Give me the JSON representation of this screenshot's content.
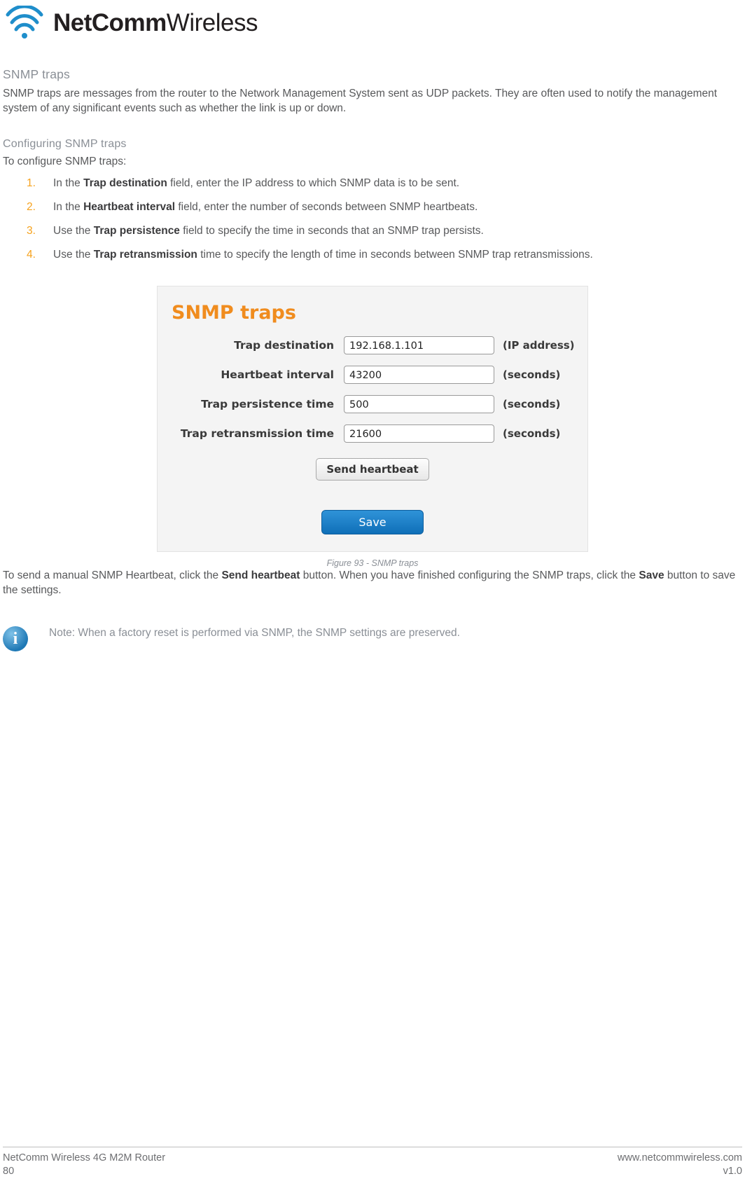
{
  "header": {
    "logo_bold": "NetComm",
    "logo_light": "Wireless",
    "logo_icon": "wifi-arc-icon"
  },
  "content": {
    "section_title": "SNMP traps",
    "intro_paragraph": "SNMP traps are messages from the router to the Network Management System sent as UDP packets. They are often used to notify the management system of any significant events such as whether the link is up or down.",
    "sub_title": "Configuring SNMP traps",
    "lead_in": "To configure SNMP traps:",
    "steps": [
      {
        "pre": "In the ",
        "bold": "Trap destination",
        "post": " field, enter the IP address to which SNMP data is to be sent."
      },
      {
        "pre": "In the ",
        "bold": "Heartbeat interval",
        "post": " field, enter the number of seconds between SNMP heartbeats."
      },
      {
        "pre": "Use the ",
        "bold": "Trap persistence",
        "post": " field to specify the time in seconds that an SNMP trap persists."
      },
      {
        "pre": "Use the ",
        "bold": "Trap retransmission",
        "post": " time to specify the length of time in seconds between SNMP trap retransmissions."
      }
    ],
    "closing": {
      "p1": "To send a manual SNMP Heartbeat, click the ",
      "b1": "Send heartbeat",
      "p2": " button. When you have finished configuring the SNMP traps, click the ",
      "b2": "Save",
      "p3": " button to save the settings."
    },
    "note": {
      "icon": "info-icon",
      "text": "Note: When a factory reset is performed via SNMP, the SNMP settings are preserved."
    }
  },
  "figure": {
    "panel_title": "SNMP traps",
    "rows": [
      {
        "label": "Trap destination",
        "value": "192.168.1.101",
        "suffix": "(IP address)"
      },
      {
        "label": "Heartbeat interval",
        "value": "43200",
        "suffix": "(seconds)"
      },
      {
        "label": "Trap persistence time",
        "value": "500",
        "suffix": "(seconds)"
      },
      {
        "label": "Trap retransmission time",
        "value": "21600",
        "suffix": "(seconds)"
      }
    ],
    "heartbeat_button": "Send heartbeat",
    "save_button": "Save",
    "caption": "Figure 93 - SNMP traps"
  },
  "footer": {
    "left_top": "NetComm Wireless 4G M2M Router",
    "left_bottom": "80",
    "right_top": "www.netcommwireless.com",
    "right_bottom": "v1.0"
  }
}
